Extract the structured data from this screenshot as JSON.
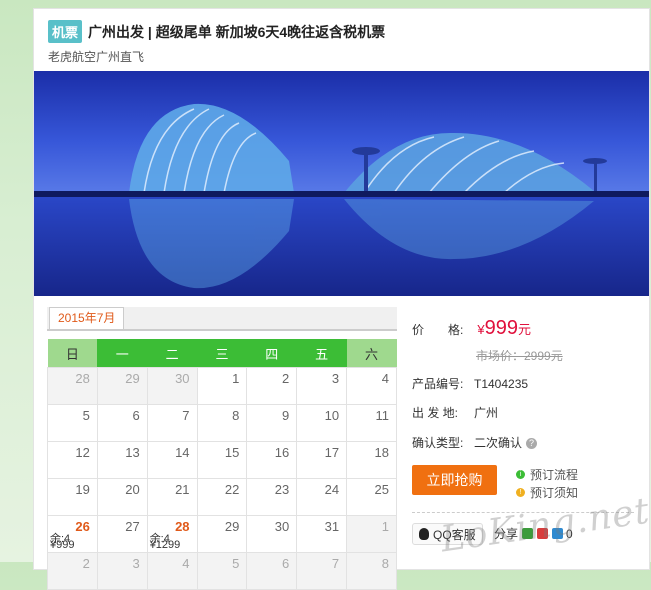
{
  "product": {
    "tag": "机票",
    "title": "广州出发 | 超级尾单 新加坡6天4晚往返含税机票",
    "subtitle": "老虎航空广州直飞"
  },
  "calendar": {
    "month_tab": "2015年7月",
    "weekdays": [
      "日",
      "一",
      "二",
      "三",
      "四",
      "五",
      "六"
    ],
    "rows": [
      [
        {
          "d": "28",
          "out": true
        },
        {
          "d": "29",
          "out": true
        },
        {
          "d": "30",
          "out": true
        },
        {
          "d": "1"
        },
        {
          "d": "2"
        },
        {
          "d": "3"
        },
        {
          "d": "4"
        }
      ],
      [
        {
          "d": "5"
        },
        {
          "d": "6"
        },
        {
          "d": "7"
        },
        {
          "d": "8"
        },
        {
          "d": "9"
        },
        {
          "d": "10"
        },
        {
          "d": "11"
        }
      ],
      [
        {
          "d": "12"
        },
        {
          "d": "13"
        },
        {
          "d": "14"
        },
        {
          "d": "15"
        },
        {
          "d": "16"
        },
        {
          "d": "17"
        },
        {
          "d": "18"
        }
      ],
      [
        {
          "d": "19"
        },
        {
          "d": "20"
        },
        {
          "d": "21"
        },
        {
          "d": "22"
        },
        {
          "d": "23"
        },
        {
          "d": "24"
        },
        {
          "d": "25"
        }
      ],
      [
        {
          "d": "26",
          "hl": true,
          "rem": "余:4",
          "price": "¥999"
        },
        {
          "d": "27"
        },
        {
          "d": "28",
          "hl": true,
          "rem": "余:4",
          "price": "¥1299"
        },
        {
          "d": "29"
        },
        {
          "d": "30"
        },
        {
          "d": "31"
        },
        {
          "d": "1",
          "out": true
        }
      ],
      [
        {
          "d": "2",
          "out": true
        },
        {
          "d": "3",
          "out": true
        },
        {
          "d": "4",
          "out": true
        },
        {
          "d": "5",
          "out": true
        },
        {
          "d": "6",
          "out": true
        },
        {
          "d": "7",
          "out": true
        },
        {
          "d": "8",
          "out": true
        }
      ]
    ]
  },
  "info": {
    "price_label": "价　　格:",
    "price_currency": "¥",
    "price_value": "999",
    "price_unit": "元",
    "market_price": "市场价：2999元",
    "code_label": "产品编号:",
    "code_value": "T1404235",
    "origin_label": "出 发 地:",
    "origin_value": "广州",
    "confirm_label": "确认类型:",
    "confirm_value": "二次确认",
    "buy_button": "立即抢购",
    "link_process": "预订流程",
    "link_notice": "预订须知",
    "qq_label": "QQ客服",
    "share_label": "分享",
    "share_count": "0"
  },
  "colors": {
    "accent_green": "#3cbd36",
    "weekend_green": "#9fd98e",
    "price_red": "#e0103c",
    "buy_orange": "#f07010",
    "tag_teal": "#59c0c9"
  },
  "watermark": "LoKing.net"
}
